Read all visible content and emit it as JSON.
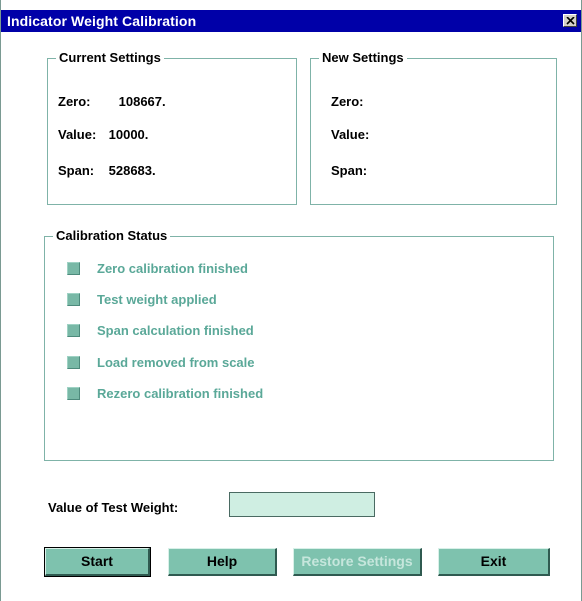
{
  "window": {
    "title": "Indicator Weight Calibration",
    "close_symbol": "close-x-icon"
  },
  "current_settings": {
    "heading": "Current Settings",
    "zero_label": "Zero:",
    "zero_value": "108667.",
    "value_label": "Value:",
    "value_value": "10000.",
    "span_label": "Span:",
    "span_value": "528683."
  },
  "new_settings": {
    "heading": "New Settings",
    "zero_label": "Zero:",
    "value_label": "Value:",
    "span_label": "Span:"
  },
  "calibration_status": {
    "heading": "Calibration Status",
    "items": [
      {
        "label": "Zero calibration finished",
        "checked": false
      },
      {
        "label": "Test weight applied",
        "checked": false
      },
      {
        "label": "Span calculation finished",
        "checked": false
      },
      {
        "label": "Load removed from scale",
        "checked": false
      },
      {
        "label": "Rezero calibration finished",
        "checked": false
      }
    ]
  },
  "test_weight": {
    "label": "Value of Test Weight:",
    "value": ""
  },
  "buttons": {
    "start": "Start",
    "help": "Help",
    "restore": "Restore Settings",
    "exit": "Exit"
  },
  "colors": {
    "title_bar": "#0000a8",
    "accent_teal": "#7ec2ae",
    "status_text": "#5aa898",
    "input_bg": "#cfeee2"
  }
}
